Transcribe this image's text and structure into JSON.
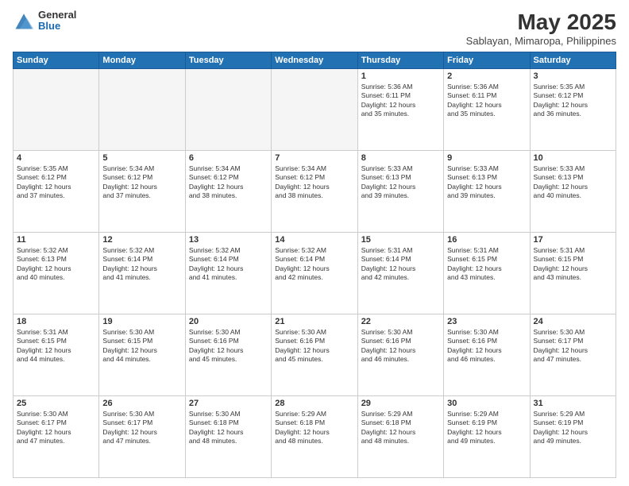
{
  "logo": {
    "general": "General",
    "blue": "Blue"
  },
  "title": "May 2025",
  "subtitle": "Sablayan, Mimaropa, Philippines",
  "headers": [
    "Sunday",
    "Monday",
    "Tuesday",
    "Wednesday",
    "Thursday",
    "Friday",
    "Saturday"
  ],
  "weeks": [
    [
      {
        "day": "",
        "info": "",
        "empty": true
      },
      {
        "day": "",
        "info": "",
        "empty": true
      },
      {
        "day": "",
        "info": "",
        "empty": true
      },
      {
        "day": "",
        "info": "",
        "empty": true
      },
      {
        "day": "1",
        "info": "Sunrise: 5:36 AM\nSunset: 6:11 PM\nDaylight: 12 hours\nand 35 minutes.",
        "empty": false
      },
      {
        "day": "2",
        "info": "Sunrise: 5:36 AM\nSunset: 6:11 PM\nDaylight: 12 hours\nand 35 minutes.",
        "empty": false
      },
      {
        "day": "3",
        "info": "Sunrise: 5:35 AM\nSunset: 6:12 PM\nDaylight: 12 hours\nand 36 minutes.",
        "empty": false
      }
    ],
    [
      {
        "day": "4",
        "info": "Sunrise: 5:35 AM\nSunset: 6:12 PM\nDaylight: 12 hours\nand 37 minutes.",
        "empty": false
      },
      {
        "day": "5",
        "info": "Sunrise: 5:34 AM\nSunset: 6:12 PM\nDaylight: 12 hours\nand 37 minutes.",
        "empty": false
      },
      {
        "day": "6",
        "info": "Sunrise: 5:34 AM\nSunset: 6:12 PM\nDaylight: 12 hours\nand 38 minutes.",
        "empty": false
      },
      {
        "day": "7",
        "info": "Sunrise: 5:34 AM\nSunset: 6:12 PM\nDaylight: 12 hours\nand 38 minutes.",
        "empty": false
      },
      {
        "day": "8",
        "info": "Sunrise: 5:33 AM\nSunset: 6:13 PM\nDaylight: 12 hours\nand 39 minutes.",
        "empty": false
      },
      {
        "day": "9",
        "info": "Sunrise: 5:33 AM\nSunset: 6:13 PM\nDaylight: 12 hours\nand 39 minutes.",
        "empty": false
      },
      {
        "day": "10",
        "info": "Sunrise: 5:33 AM\nSunset: 6:13 PM\nDaylight: 12 hours\nand 40 minutes.",
        "empty": false
      }
    ],
    [
      {
        "day": "11",
        "info": "Sunrise: 5:32 AM\nSunset: 6:13 PM\nDaylight: 12 hours\nand 40 minutes.",
        "empty": false
      },
      {
        "day": "12",
        "info": "Sunrise: 5:32 AM\nSunset: 6:14 PM\nDaylight: 12 hours\nand 41 minutes.",
        "empty": false
      },
      {
        "day": "13",
        "info": "Sunrise: 5:32 AM\nSunset: 6:14 PM\nDaylight: 12 hours\nand 41 minutes.",
        "empty": false
      },
      {
        "day": "14",
        "info": "Sunrise: 5:32 AM\nSunset: 6:14 PM\nDaylight: 12 hours\nand 42 minutes.",
        "empty": false
      },
      {
        "day": "15",
        "info": "Sunrise: 5:31 AM\nSunset: 6:14 PM\nDaylight: 12 hours\nand 42 minutes.",
        "empty": false
      },
      {
        "day": "16",
        "info": "Sunrise: 5:31 AM\nSunset: 6:15 PM\nDaylight: 12 hours\nand 43 minutes.",
        "empty": false
      },
      {
        "day": "17",
        "info": "Sunrise: 5:31 AM\nSunset: 6:15 PM\nDaylight: 12 hours\nand 43 minutes.",
        "empty": false
      }
    ],
    [
      {
        "day": "18",
        "info": "Sunrise: 5:31 AM\nSunset: 6:15 PM\nDaylight: 12 hours\nand 44 minutes.",
        "empty": false
      },
      {
        "day": "19",
        "info": "Sunrise: 5:30 AM\nSunset: 6:15 PM\nDaylight: 12 hours\nand 44 minutes.",
        "empty": false
      },
      {
        "day": "20",
        "info": "Sunrise: 5:30 AM\nSunset: 6:16 PM\nDaylight: 12 hours\nand 45 minutes.",
        "empty": false
      },
      {
        "day": "21",
        "info": "Sunrise: 5:30 AM\nSunset: 6:16 PM\nDaylight: 12 hours\nand 45 minutes.",
        "empty": false
      },
      {
        "day": "22",
        "info": "Sunrise: 5:30 AM\nSunset: 6:16 PM\nDaylight: 12 hours\nand 46 minutes.",
        "empty": false
      },
      {
        "day": "23",
        "info": "Sunrise: 5:30 AM\nSunset: 6:16 PM\nDaylight: 12 hours\nand 46 minutes.",
        "empty": false
      },
      {
        "day": "24",
        "info": "Sunrise: 5:30 AM\nSunset: 6:17 PM\nDaylight: 12 hours\nand 47 minutes.",
        "empty": false
      }
    ],
    [
      {
        "day": "25",
        "info": "Sunrise: 5:30 AM\nSunset: 6:17 PM\nDaylight: 12 hours\nand 47 minutes.",
        "empty": false
      },
      {
        "day": "26",
        "info": "Sunrise: 5:30 AM\nSunset: 6:17 PM\nDaylight: 12 hours\nand 47 minutes.",
        "empty": false
      },
      {
        "day": "27",
        "info": "Sunrise: 5:30 AM\nSunset: 6:18 PM\nDaylight: 12 hours\nand 48 minutes.",
        "empty": false
      },
      {
        "day": "28",
        "info": "Sunrise: 5:29 AM\nSunset: 6:18 PM\nDaylight: 12 hours\nand 48 minutes.",
        "empty": false
      },
      {
        "day": "29",
        "info": "Sunrise: 5:29 AM\nSunset: 6:18 PM\nDaylight: 12 hours\nand 48 minutes.",
        "empty": false
      },
      {
        "day": "30",
        "info": "Sunrise: 5:29 AM\nSunset: 6:19 PM\nDaylight: 12 hours\nand 49 minutes.",
        "empty": false
      },
      {
        "day": "31",
        "info": "Sunrise: 5:29 AM\nSunset: 6:19 PM\nDaylight: 12 hours\nand 49 minutes.",
        "empty": false
      }
    ]
  ]
}
